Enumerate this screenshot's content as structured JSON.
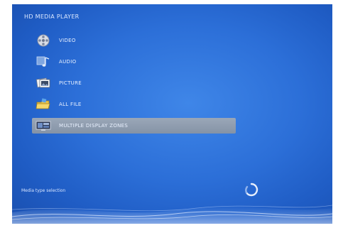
{
  "header": {
    "title": "HD MEDIA PLAYER"
  },
  "menu": {
    "items": [
      {
        "label": "VIDEO",
        "icon": "film-reel-icon"
      },
      {
        "label": "AUDIO",
        "icon": "music-note-icon"
      },
      {
        "label": "PICTURE",
        "icon": "picture-icon"
      },
      {
        "label": "ALL FILE",
        "icon": "folder-icon"
      },
      {
        "label": "MULTIPLE DISPLAY ZONES",
        "icon": "display-zones-icon",
        "selected": true
      }
    ]
  },
  "status": {
    "text": "Media type selection"
  },
  "colors": {
    "background": "#2c6fd8",
    "selection": "#909cae",
    "text": "#e8f0ff"
  }
}
